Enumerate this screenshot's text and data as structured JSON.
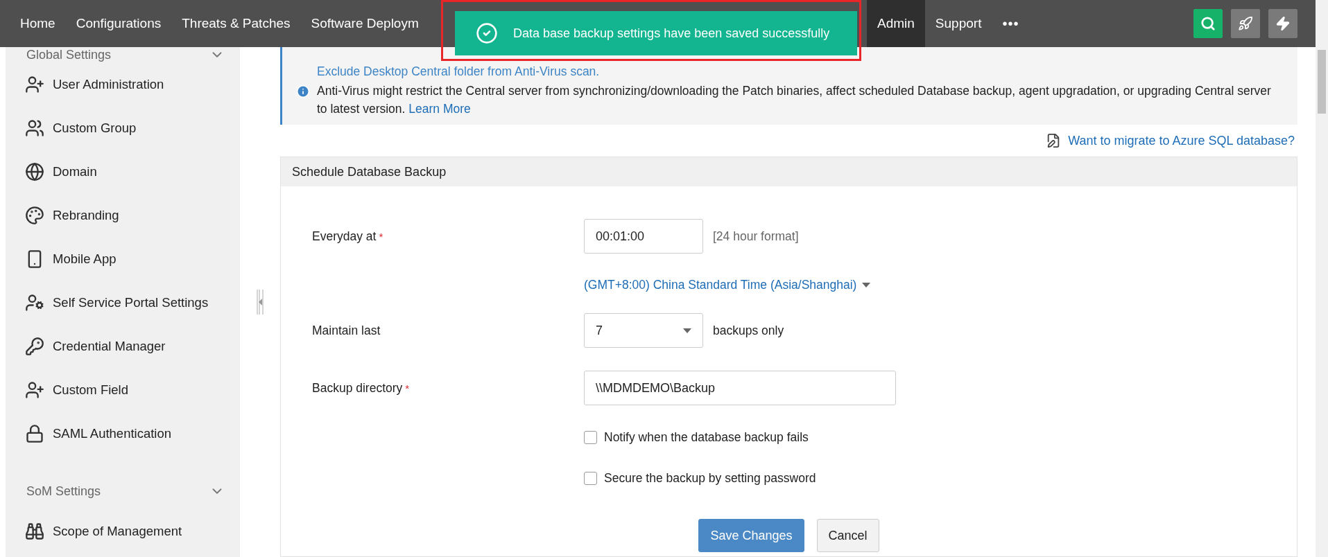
{
  "nav": {
    "items": [
      {
        "label": "Home",
        "selected": false
      },
      {
        "label": "Configurations",
        "selected": false
      },
      {
        "label": "Threats & Patches",
        "selected": false
      },
      {
        "label": "Software Deploym",
        "selected": false
      },
      {
        "label": "Admin",
        "selected": true
      },
      {
        "label": "Support",
        "selected": false
      }
    ],
    "more": "•••"
  },
  "toast": {
    "message": "Data base backup settings have been saved successfully"
  },
  "sidebar": {
    "sections": [
      {
        "title": "Global Settings",
        "expanded": true,
        "items": [
          {
            "label": "User Administration"
          },
          {
            "label": "Custom Group"
          },
          {
            "label": "Domain"
          },
          {
            "label": "Rebranding"
          },
          {
            "label": "Mobile App"
          },
          {
            "label": "Self Service Portal Settings"
          },
          {
            "label": "Credential Manager"
          },
          {
            "label": "Custom Field"
          },
          {
            "label": "SAML Authentication"
          }
        ]
      },
      {
        "title": "SoM Settings",
        "expanded": true,
        "items": [
          {
            "label": "Scope of Management"
          }
        ]
      }
    ]
  },
  "banner": {
    "title": "Exclude Desktop Central folder from Anti-Virus scan.",
    "text": "Anti-Virus might restrict the Central server from synchronizing/downloading the Patch binaries, affect scheduled Database backup, agent upgradation, or upgrading Central server to latest version.",
    "link": "Learn More"
  },
  "migrate_link": "Want to migrate to Azure SQL database?",
  "panel": {
    "title": "Schedule Database Backup",
    "everyday": {
      "label": "Everyday at",
      "required_mark": "*",
      "value": "00:01:00",
      "hint": "[24 hour format]"
    },
    "timezone": "(GMT+8:00) China Standard Time (Asia/Shanghai)",
    "maintain": {
      "label": "Maintain last",
      "value": "7",
      "suffix": "backups only"
    },
    "directory": {
      "label": "Backup directory",
      "required_mark": "*",
      "value": "\\\\MDMDEMO\\Backup"
    },
    "checkboxes": [
      {
        "label": "Notify when the database backup fails",
        "checked": false
      },
      {
        "label": "Secure the backup by setting password",
        "checked": false
      }
    ],
    "buttons": [
      {
        "label": "Save Changes",
        "kind": "primary"
      },
      {
        "label": "Cancel",
        "kind": "secondary"
      }
    ]
  }
}
